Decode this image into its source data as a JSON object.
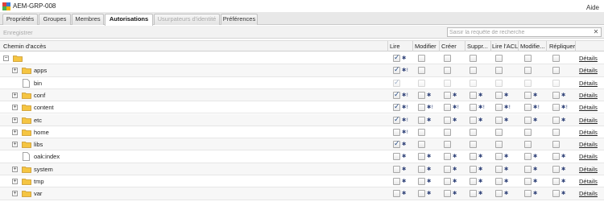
{
  "app": {
    "title": "AEM-GRP-008",
    "help": "Aide"
  },
  "tabs": [
    {
      "label": "Propriétés",
      "state": "normal"
    },
    {
      "label": "Groupes",
      "state": "normal"
    },
    {
      "label": "Membres",
      "state": "normal"
    },
    {
      "label": "Autorisations",
      "state": "active"
    },
    {
      "label": "Usurpateurs d'identité",
      "state": "disabled"
    },
    {
      "label": "Préférences",
      "state": "normal"
    }
  ],
  "toolbar": {
    "register_label": "Enregistrer",
    "search_placeholder": "Saisir la requête de recherche"
  },
  "columns": [
    "Chemin d'accès",
    "Lire",
    "Modifier",
    "Créer",
    "Suppr...",
    "Lire l'ACL",
    "Modifie...",
    "Répliquer"
  ],
  "details_label": "Détails",
  "rows": [
    {
      "name": "",
      "level": 0,
      "type": "folder",
      "expander": "−",
      "perms": [
        {
          "c": true,
          "m": "✱"
        },
        {
          "c": false,
          "m": ""
        },
        {
          "c": false,
          "m": ""
        },
        {
          "c": false,
          "m": ""
        },
        {
          "c": false,
          "m": ""
        },
        {
          "c": false,
          "m": ""
        },
        {
          "c": false,
          "m": ""
        }
      ]
    },
    {
      "name": "apps",
      "level": 1,
      "type": "folder",
      "expander": "+",
      "perms": [
        {
          "c": true,
          "m": "✱!"
        },
        {
          "c": false,
          "m": ""
        },
        {
          "c": false,
          "m": ""
        },
        {
          "c": false,
          "m": ""
        },
        {
          "c": false,
          "m": ""
        },
        {
          "c": false,
          "m": ""
        },
        {
          "c": false,
          "m": ""
        }
      ]
    },
    {
      "name": "bin",
      "level": 1,
      "type": "file",
      "expander": "",
      "dim": true,
      "perms": [
        {
          "c": true,
          "m": ""
        },
        {
          "c": false,
          "m": ""
        },
        {
          "c": false,
          "m": ""
        },
        {
          "c": false,
          "m": ""
        },
        {
          "c": false,
          "m": ""
        },
        {
          "c": false,
          "m": ""
        },
        {
          "c": false,
          "m": ""
        }
      ]
    },
    {
      "name": "conf",
      "level": 1,
      "type": "folder",
      "expander": "+",
      "perms": [
        {
          "c": true,
          "m": "✱!"
        },
        {
          "c": false,
          "m": "✱"
        },
        {
          "c": false,
          "m": "✱"
        },
        {
          "c": false,
          "m": "✱"
        },
        {
          "c": false,
          "m": "✱"
        },
        {
          "c": false,
          "m": "✱"
        },
        {
          "c": false,
          "m": "✱"
        }
      ]
    },
    {
      "name": "content",
      "level": 1,
      "type": "folder",
      "expander": "+",
      "perms": [
        {
          "c": true,
          "m": "✱!"
        },
        {
          "c": false,
          "m": "✱!"
        },
        {
          "c": false,
          "m": "✱!"
        },
        {
          "c": false,
          "m": "✱!"
        },
        {
          "c": false,
          "m": "✱!"
        },
        {
          "c": false,
          "m": "✱!"
        },
        {
          "c": false,
          "m": "✱!"
        }
      ]
    },
    {
      "name": "etc",
      "level": 1,
      "type": "folder",
      "expander": "+",
      "perms": [
        {
          "c": true,
          "m": "✱!"
        },
        {
          "c": false,
          "m": "✱"
        },
        {
          "c": false,
          "m": "✱"
        },
        {
          "c": false,
          "m": "✱"
        },
        {
          "c": false,
          "m": "✱"
        },
        {
          "c": false,
          "m": "✱"
        },
        {
          "c": false,
          "m": "✱"
        }
      ]
    },
    {
      "name": "home",
      "level": 1,
      "type": "folder",
      "expander": "+",
      "perms": [
        {
          "c": false,
          "m": "✱!"
        },
        {
          "c": false,
          "m": ""
        },
        {
          "c": false,
          "m": ""
        },
        {
          "c": false,
          "m": ""
        },
        {
          "c": false,
          "m": ""
        },
        {
          "c": false,
          "m": ""
        },
        {
          "c": false,
          "m": ""
        }
      ]
    },
    {
      "name": "libs",
      "level": 1,
      "type": "folder",
      "expander": "+",
      "perms": [
        {
          "c": true,
          "m": "✱"
        },
        {
          "c": false,
          "m": ""
        },
        {
          "c": false,
          "m": ""
        },
        {
          "c": false,
          "m": ""
        },
        {
          "c": false,
          "m": ""
        },
        {
          "c": false,
          "m": ""
        },
        {
          "c": false,
          "m": ""
        }
      ]
    },
    {
      "name": "oak:index",
      "level": 1,
      "type": "file",
      "expander": "",
      "perms": [
        {
          "c": false,
          "m": "✱"
        },
        {
          "c": false,
          "m": "✱"
        },
        {
          "c": false,
          "m": "✱"
        },
        {
          "c": false,
          "m": "✱"
        },
        {
          "c": false,
          "m": "✱"
        },
        {
          "c": false,
          "m": "✱"
        },
        {
          "c": false,
          "m": "✱"
        }
      ]
    },
    {
      "name": "system",
      "level": 1,
      "type": "folder",
      "expander": "+",
      "perms": [
        {
          "c": false,
          "m": "✱"
        },
        {
          "c": false,
          "m": "✱"
        },
        {
          "c": false,
          "m": "✱"
        },
        {
          "c": false,
          "m": "✱"
        },
        {
          "c": false,
          "m": "✱"
        },
        {
          "c": false,
          "m": "✱"
        },
        {
          "c": false,
          "m": "✱"
        }
      ]
    },
    {
      "name": "tmp",
      "level": 1,
      "type": "folder",
      "expander": "+",
      "perms": [
        {
          "c": false,
          "m": "✱"
        },
        {
          "c": false,
          "m": "✱"
        },
        {
          "c": false,
          "m": "✱"
        },
        {
          "c": false,
          "m": "✱"
        },
        {
          "c": false,
          "m": "✱"
        },
        {
          "c": false,
          "m": "✱"
        },
        {
          "c": false,
          "m": "✱"
        }
      ]
    },
    {
      "name": "var",
      "level": 1,
      "type": "folder",
      "expander": "+",
      "perms": [
        {
          "c": false,
          "m": "✱"
        },
        {
          "c": false,
          "m": "✱"
        },
        {
          "c": false,
          "m": "✱"
        },
        {
          "c": false,
          "m": "✱"
        },
        {
          "c": false,
          "m": "✱"
        },
        {
          "c": false,
          "m": "✱"
        },
        {
          "c": false,
          "m": "✱"
        }
      ]
    }
  ],
  "colors": {
    "folder": "#f5c542",
    "folder_edge": "#c8962a",
    "checkmark": "#2b4f86",
    "mark": "#33457a"
  },
  "icons": {
    "app": "aem-logo-icon",
    "folder": "folder-icon",
    "file": "file-icon",
    "clear": "clear-icon"
  }
}
